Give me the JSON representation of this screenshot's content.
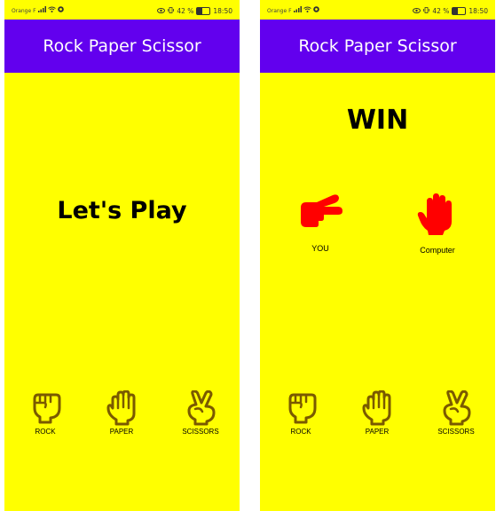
{
  "colors": {
    "background": "#ffff00",
    "appbar": "#6200ee",
    "icon_outline": "#7a5a00",
    "result_icon": "#ff0000"
  },
  "status_bar": {
    "carrier": "Orange F",
    "battery": "42 %",
    "time": "18:50"
  },
  "app": {
    "title": "Rock Paper Scissor"
  },
  "screen1": {
    "headline": "Let's Play"
  },
  "screen2": {
    "result": "WIN",
    "you_label": "YOU",
    "computer_label": "Computer",
    "you_icon": "scissors-hand-icon",
    "computer_icon": "paper-hand-icon"
  },
  "choices": [
    {
      "label": "ROCK",
      "icon": "rock-hand-icon"
    },
    {
      "label": "PAPER",
      "icon": "paper-hand-icon"
    },
    {
      "label": "SCISSORS",
      "icon": "scissors-hand-icon"
    }
  ]
}
